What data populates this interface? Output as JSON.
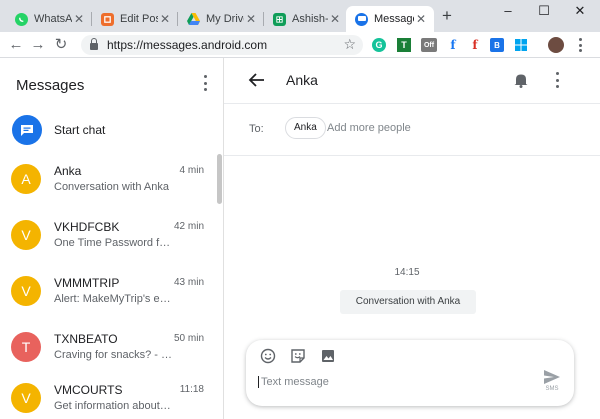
{
  "browser": {
    "tabs": [
      {
        "title": "WhatsApp",
        "icon": "whatsapp-icon",
        "color": "#25d366"
      },
      {
        "title": "Edit Post",
        "icon": "blogger-icon",
        "color": "#ee6e2c"
      },
      {
        "title": "My Drive",
        "icon": "google-drive-icon",
        "color": "#fbbc04"
      },
      {
        "title": "Ashish-Fr",
        "icon": "google-sheets-icon",
        "color": "#0f9d58"
      },
      {
        "title": "Message",
        "icon": "messages-icon",
        "color": "#1a73e8",
        "active": true
      }
    ],
    "url": "https://messages.android.com",
    "extension_badge": "Off"
  },
  "sidebar": {
    "title": "Messages",
    "start_chat_label": "Start chat",
    "conversations": [
      {
        "initial": "A",
        "name": "Anka",
        "snippet": "Conversation with Anka",
        "time": "4 min",
        "avatar_color": "#f4b400"
      },
      {
        "initial": "V",
        "name": "VKHDFCBK",
        "snippet": "One Time Password for ...",
        "time": "42 min",
        "avatar_color": "#f4b400"
      },
      {
        "initial": "V",
        "name": "VMMMTRIP",
        "snippet": "Alert: MakeMyTrip's em...",
        "time": "43 min",
        "avatar_color": "#f4b400"
      },
      {
        "initial": "T",
        "name": "TXNBEATO",
        "snippet": "Craving for snacks? - Ch...",
        "time": "50 min",
        "avatar_color": "#e8625d"
      },
      {
        "initial": "V",
        "name": "VMCOURTS",
        "snippet": "Get information about y...",
        "time": "11:18",
        "avatar_color": "#f4b400"
      }
    ]
  },
  "conversation": {
    "title": "Anka",
    "to_label": "To:",
    "recipient": "Anka",
    "add_people_placeholder": "Add more people",
    "timestamp": "14:15",
    "system_message": "Conversation with Anka",
    "composer_placeholder": "Text message",
    "send_label": "SMS"
  },
  "colors": {
    "accent": "#1a73e8",
    "avatar_yellow": "#f4b400",
    "avatar_red": "#e8625d"
  }
}
